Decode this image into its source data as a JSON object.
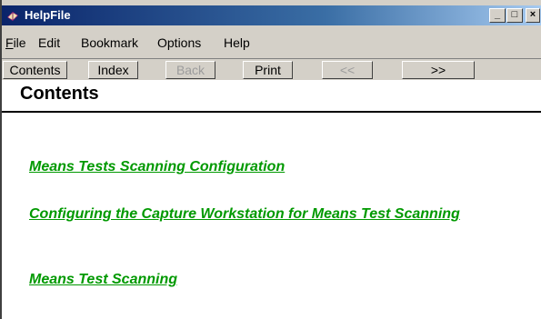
{
  "window": {
    "title": "HelpFile"
  },
  "controls": {
    "minimize": "_",
    "maximize": "□",
    "close": "×"
  },
  "menu": {
    "items": [
      "File",
      "Edit",
      "Bookmark",
      "Options",
      "Help"
    ]
  },
  "toolbar": {
    "buttons": [
      "Contents",
      "Index",
      "Back",
      "Print",
      "<<",
      ">>"
    ]
  },
  "content": {
    "heading": "Contents",
    "links": [
      "Means Tests Scanning Configuration",
      "Configuring the Capture Workstation for Means Test Scanning",
      "Means Test Scanning"
    ]
  }
}
